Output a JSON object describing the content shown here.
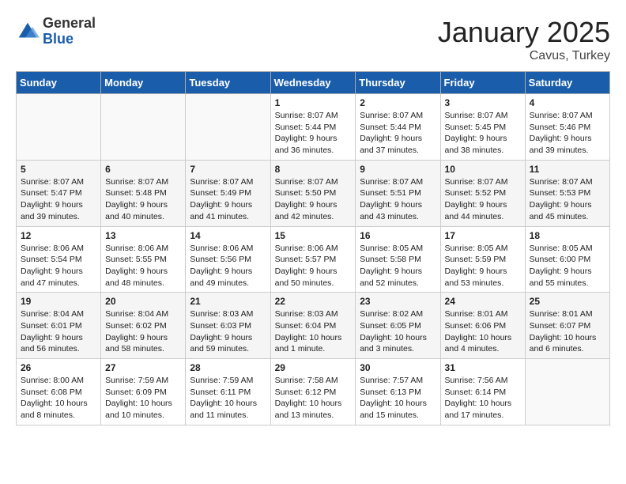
{
  "header": {
    "logo_general": "General",
    "logo_blue": "Blue",
    "month": "January 2025",
    "location": "Cavus, Turkey"
  },
  "weekdays": [
    "Sunday",
    "Monday",
    "Tuesday",
    "Wednesday",
    "Thursday",
    "Friday",
    "Saturday"
  ],
  "weeks": [
    [
      {
        "day": "",
        "info": ""
      },
      {
        "day": "",
        "info": ""
      },
      {
        "day": "",
        "info": ""
      },
      {
        "day": "1",
        "info": "Sunrise: 8:07 AM\nSunset: 5:44 PM\nDaylight: 9 hours\nand 36 minutes."
      },
      {
        "day": "2",
        "info": "Sunrise: 8:07 AM\nSunset: 5:44 PM\nDaylight: 9 hours\nand 37 minutes."
      },
      {
        "day": "3",
        "info": "Sunrise: 8:07 AM\nSunset: 5:45 PM\nDaylight: 9 hours\nand 38 minutes."
      },
      {
        "day": "4",
        "info": "Sunrise: 8:07 AM\nSunset: 5:46 PM\nDaylight: 9 hours\nand 39 minutes."
      }
    ],
    [
      {
        "day": "5",
        "info": "Sunrise: 8:07 AM\nSunset: 5:47 PM\nDaylight: 9 hours\nand 39 minutes."
      },
      {
        "day": "6",
        "info": "Sunrise: 8:07 AM\nSunset: 5:48 PM\nDaylight: 9 hours\nand 40 minutes."
      },
      {
        "day": "7",
        "info": "Sunrise: 8:07 AM\nSunset: 5:49 PM\nDaylight: 9 hours\nand 41 minutes."
      },
      {
        "day": "8",
        "info": "Sunrise: 8:07 AM\nSunset: 5:50 PM\nDaylight: 9 hours\nand 42 minutes."
      },
      {
        "day": "9",
        "info": "Sunrise: 8:07 AM\nSunset: 5:51 PM\nDaylight: 9 hours\nand 43 minutes."
      },
      {
        "day": "10",
        "info": "Sunrise: 8:07 AM\nSunset: 5:52 PM\nDaylight: 9 hours\nand 44 minutes."
      },
      {
        "day": "11",
        "info": "Sunrise: 8:07 AM\nSunset: 5:53 PM\nDaylight: 9 hours\nand 45 minutes."
      }
    ],
    [
      {
        "day": "12",
        "info": "Sunrise: 8:06 AM\nSunset: 5:54 PM\nDaylight: 9 hours\nand 47 minutes."
      },
      {
        "day": "13",
        "info": "Sunrise: 8:06 AM\nSunset: 5:55 PM\nDaylight: 9 hours\nand 48 minutes."
      },
      {
        "day": "14",
        "info": "Sunrise: 8:06 AM\nSunset: 5:56 PM\nDaylight: 9 hours\nand 49 minutes."
      },
      {
        "day": "15",
        "info": "Sunrise: 8:06 AM\nSunset: 5:57 PM\nDaylight: 9 hours\nand 50 minutes."
      },
      {
        "day": "16",
        "info": "Sunrise: 8:05 AM\nSunset: 5:58 PM\nDaylight: 9 hours\nand 52 minutes."
      },
      {
        "day": "17",
        "info": "Sunrise: 8:05 AM\nSunset: 5:59 PM\nDaylight: 9 hours\nand 53 minutes."
      },
      {
        "day": "18",
        "info": "Sunrise: 8:05 AM\nSunset: 6:00 PM\nDaylight: 9 hours\nand 55 minutes."
      }
    ],
    [
      {
        "day": "19",
        "info": "Sunrise: 8:04 AM\nSunset: 6:01 PM\nDaylight: 9 hours\nand 56 minutes."
      },
      {
        "day": "20",
        "info": "Sunrise: 8:04 AM\nSunset: 6:02 PM\nDaylight: 9 hours\nand 58 minutes."
      },
      {
        "day": "21",
        "info": "Sunrise: 8:03 AM\nSunset: 6:03 PM\nDaylight: 9 hours\nand 59 minutes."
      },
      {
        "day": "22",
        "info": "Sunrise: 8:03 AM\nSunset: 6:04 PM\nDaylight: 10 hours\nand 1 minute."
      },
      {
        "day": "23",
        "info": "Sunrise: 8:02 AM\nSunset: 6:05 PM\nDaylight: 10 hours\nand 3 minutes."
      },
      {
        "day": "24",
        "info": "Sunrise: 8:01 AM\nSunset: 6:06 PM\nDaylight: 10 hours\nand 4 minutes."
      },
      {
        "day": "25",
        "info": "Sunrise: 8:01 AM\nSunset: 6:07 PM\nDaylight: 10 hours\nand 6 minutes."
      }
    ],
    [
      {
        "day": "26",
        "info": "Sunrise: 8:00 AM\nSunset: 6:08 PM\nDaylight: 10 hours\nand 8 minutes."
      },
      {
        "day": "27",
        "info": "Sunrise: 7:59 AM\nSunset: 6:09 PM\nDaylight: 10 hours\nand 10 minutes."
      },
      {
        "day": "28",
        "info": "Sunrise: 7:59 AM\nSunset: 6:11 PM\nDaylight: 10 hours\nand 11 minutes."
      },
      {
        "day": "29",
        "info": "Sunrise: 7:58 AM\nSunset: 6:12 PM\nDaylight: 10 hours\nand 13 minutes."
      },
      {
        "day": "30",
        "info": "Sunrise: 7:57 AM\nSunset: 6:13 PM\nDaylight: 10 hours\nand 15 minutes."
      },
      {
        "day": "31",
        "info": "Sunrise: 7:56 AM\nSunset: 6:14 PM\nDaylight: 10 hours\nand 17 minutes."
      },
      {
        "day": "",
        "info": ""
      }
    ]
  ]
}
